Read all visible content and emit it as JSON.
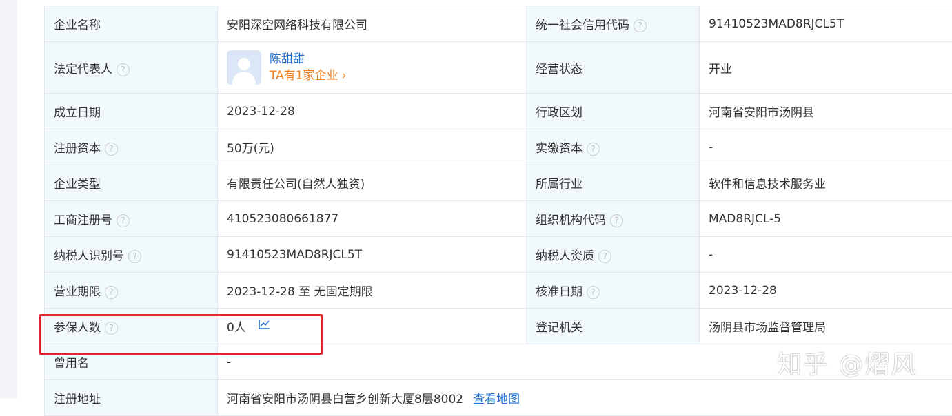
{
  "company_info": {
    "rows": [
      {
        "left_label": "企业名称",
        "left_value": "安阳深空网络科技有限公司",
        "right_label": "统一社会信用代码",
        "right_value": "91410523MAD8RJCL5T"
      },
      {
        "left_label": "法定代表人",
        "legal_rep": {
          "name": "陈甜甜",
          "link_text": "TA有1家企业",
          "link_arrow": "›"
        },
        "right_label": "经营状态",
        "right_value": "开业"
      },
      {
        "left_label": "成立日期",
        "left_value": "2023-12-28",
        "right_label": "行政区划",
        "right_value": "河南省安阳市汤阴县"
      },
      {
        "left_label": "注册资本",
        "left_value": "50万(元)",
        "right_label": "实缴资本",
        "right_value": "-"
      },
      {
        "left_label": "企业类型",
        "left_value": "有限责任公司(自然人独资)",
        "right_label": "所属行业",
        "right_value": "软件和信息技术服务业"
      },
      {
        "left_label": "工商注册号",
        "left_value": "410523080661877",
        "right_label": "组织机构代码",
        "right_value": "MAD8RJCL-5"
      },
      {
        "left_label": "纳税人识别号",
        "left_value": "91410523MAD8RJCL5T",
        "right_label": "纳税人资质",
        "right_value": "-"
      },
      {
        "left_label": "营业期限",
        "left_value": "2023-12-28 至 无固定期限",
        "right_label": "核准日期",
        "right_value": "2023-12-28"
      },
      {
        "left_label": "参保人数",
        "left_value": "0人",
        "right_label": "登记机关",
        "right_value": "汤阴县市场监督管理局"
      },
      {
        "left_label": "曾用名",
        "left_value": "-"
      },
      {
        "left_label": "注册地址",
        "left_value": "河南省安阳市汤阴县白营乡创新大厦8层8002",
        "map_link": "查看地图"
      }
    ],
    "help_glyph": "?"
  },
  "watermark": "知乎 @熠风",
  "colors": {
    "label_bg": "#f2f9fc",
    "border": "#e4e8ee",
    "link_blue": "#1f6dd0",
    "link_orange": "#f08224",
    "highlight_red": "#e0262a"
  }
}
